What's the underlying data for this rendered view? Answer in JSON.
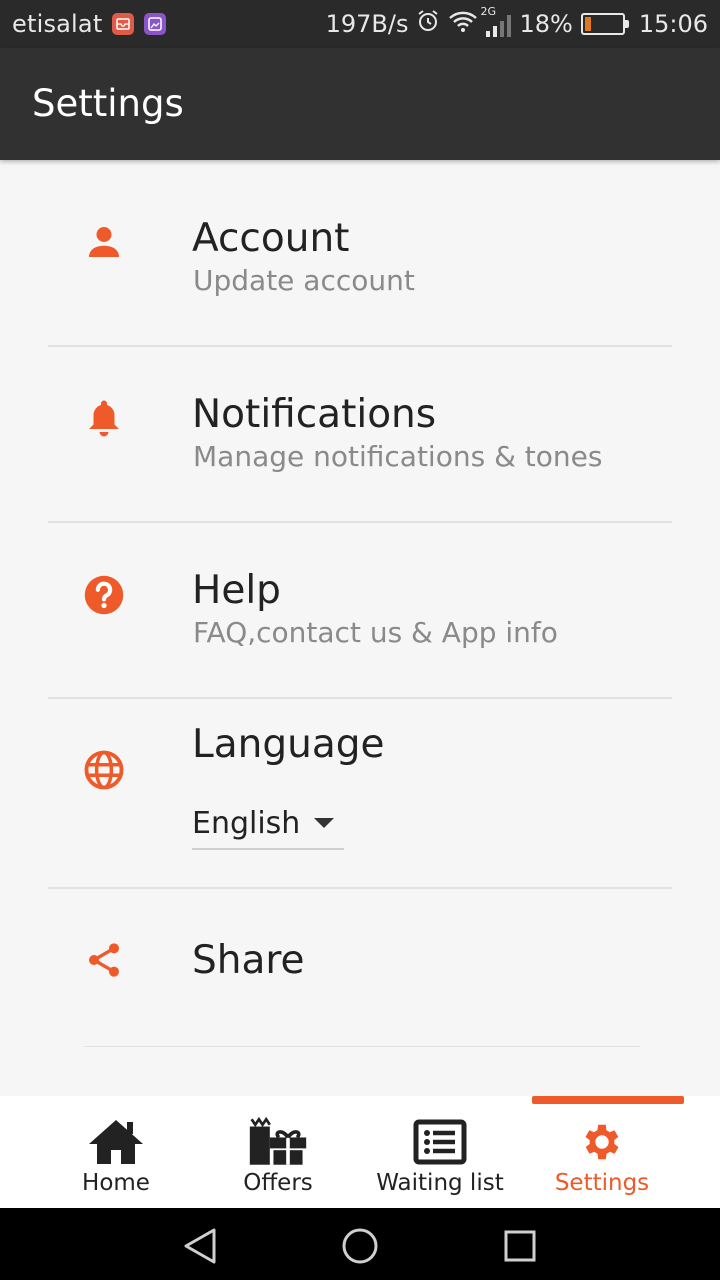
{
  "status_bar": {
    "carrier": "etisalat",
    "speed": "197B/s",
    "network": "2G",
    "battery_percent": "18%",
    "battery_level": 0.18,
    "time": "15:06"
  },
  "app_bar": {
    "title": "Settings"
  },
  "settings": {
    "items": [
      {
        "title": "Account",
        "subtitle": "Update account",
        "icon": "person-icon"
      },
      {
        "title": "Notifications",
        "subtitle": "Manage notifications & tones",
        "icon": "bell-icon"
      },
      {
        "title": "Help",
        "subtitle": "FAQ,contact us & App info",
        "icon": "help-icon"
      },
      {
        "title": "Language",
        "icon": "globe-icon",
        "selected_language": "English"
      },
      {
        "title": "Share",
        "icon": "share-icon"
      }
    ]
  },
  "bottom_nav": {
    "items": [
      {
        "label": "Home",
        "icon": "home-icon"
      },
      {
        "label": "Offers",
        "icon": "gift-icon"
      },
      {
        "label": "Waiting list",
        "icon": "list-icon"
      },
      {
        "label": "Settings",
        "icon": "gear-icon",
        "active": true
      }
    ]
  },
  "colors": {
    "accent": "#ee5a2a",
    "app_bar": "#323131",
    "status_bar": "#2b2a2a",
    "background": "#f6f6f6"
  }
}
